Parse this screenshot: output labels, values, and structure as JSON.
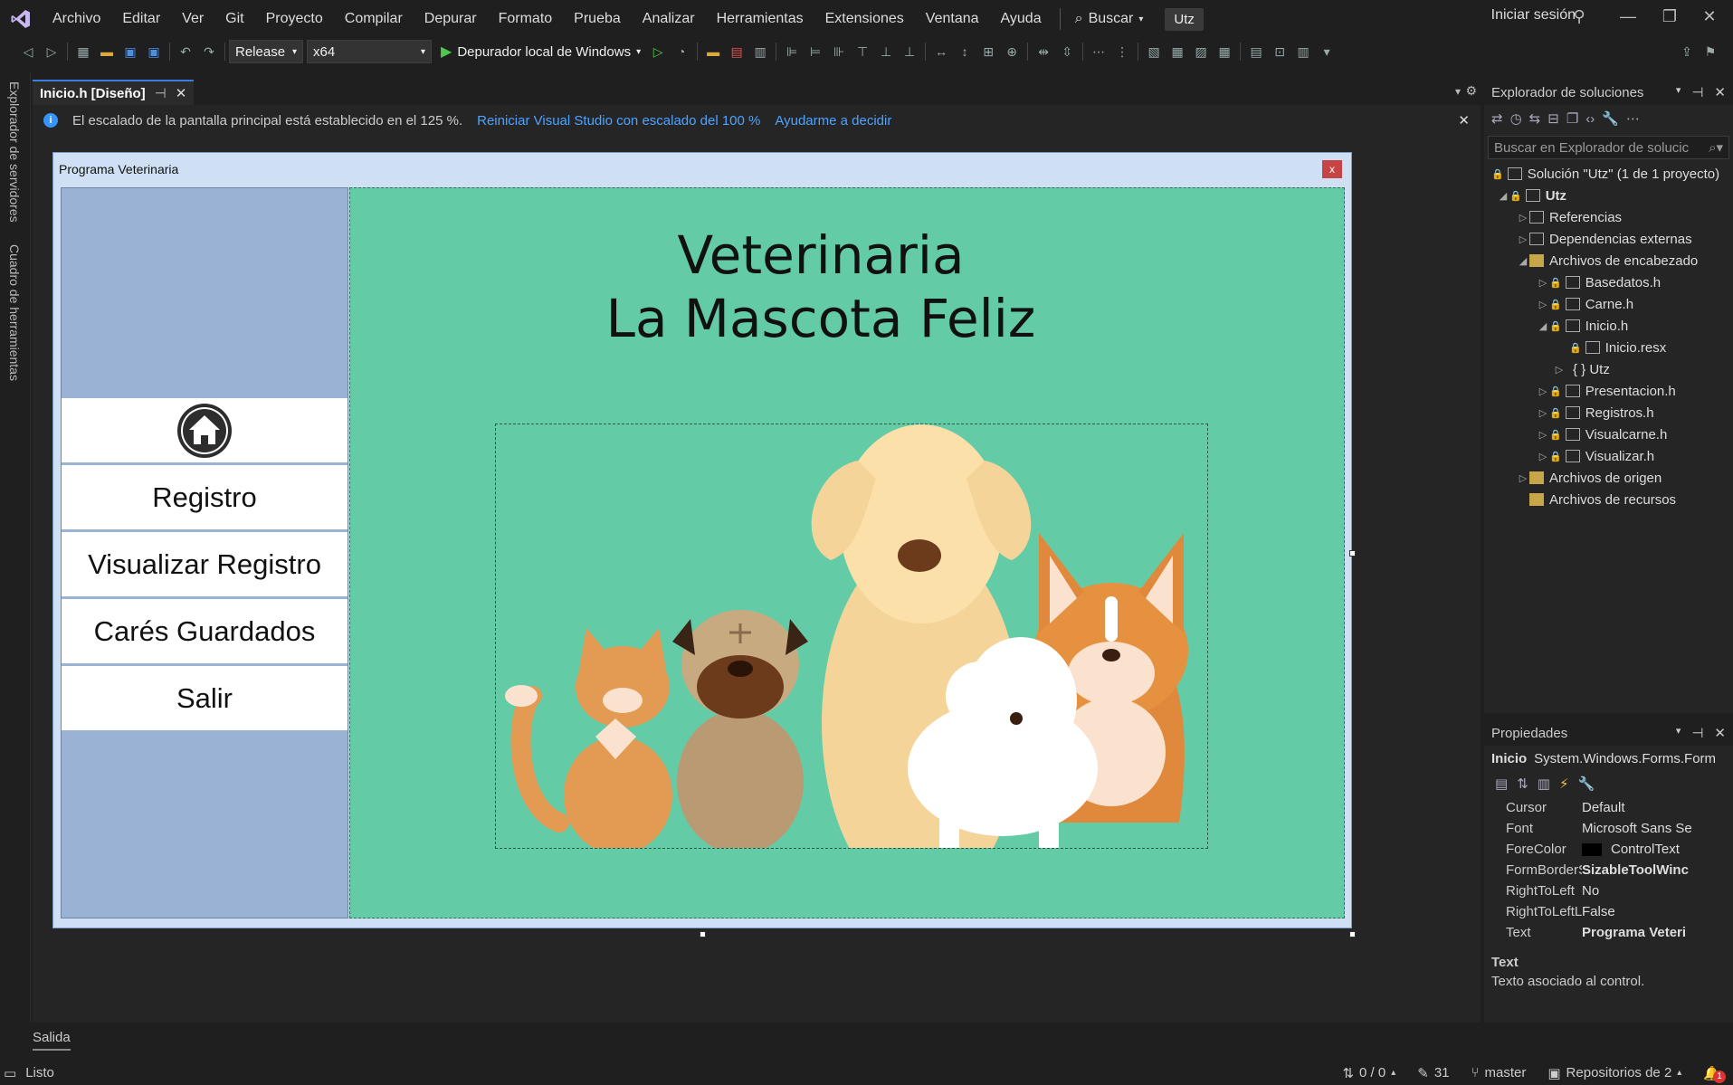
{
  "menubar": {
    "items": [
      "Archivo",
      "Editar",
      "Ver",
      "Git",
      "Proyecto",
      "Compilar",
      "Depurar",
      "Formato",
      "Prueba",
      "Analizar",
      "Herramientas",
      "Extensiones",
      "Ventana",
      "Ayuda"
    ],
    "search_label": "Buscar",
    "solution_name": "Utz",
    "sign_in": "Iniciar sesión"
  },
  "toolbar": {
    "configuration": "Release",
    "platform": "x64",
    "run_label": "Depurador local de Windows"
  },
  "left_rail": {
    "server_explorer": "Explorador de servidores",
    "toolbox": "Cuadro de herramientas"
  },
  "document": {
    "tab_title": "Inicio.h [Diseño]",
    "info_message": "El escalado de la pantalla principal está establecido en el 125 %.",
    "info_link1": "Reiniciar Visual Studio con escalado del 100 %",
    "info_link2": "Ayudarme a decidir"
  },
  "form": {
    "title": "Programa Veterinaria",
    "close_glyph": "x",
    "heading_line1": "Veterinaria",
    "heading_line2": "La Mascota Feliz",
    "nav": [
      "Registro",
      "Visualizar Registro",
      "Carés Guardados",
      "Salir"
    ],
    "colors": {
      "sidebar": "#9ab3d5",
      "content": "#63cca7"
    }
  },
  "solution_explorer": {
    "title": "Explorador de soluciones",
    "search_placeholder": "Buscar en Explorador de solucic",
    "tree": [
      {
        "label": "Solución \"Utz\"  (1 de 1 proyecto)"
      },
      {
        "label": "Utz"
      },
      {
        "label": "Referencias"
      },
      {
        "label": "Dependencias externas"
      },
      {
        "label": "Archivos de encabezado"
      },
      {
        "label": "Basedatos.h"
      },
      {
        "label": "Carne.h"
      },
      {
        "label": "Inicio.h"
      },
      {
        "label": "Inicio.resx"
      },
      {
        "label": "{ }  Utz"
      },
      {
        "label": "Presentacion.h"
      },
      {
        "label": "Registros.h"
      },
      {
        "label": "Visualcarne.h"
      },
      {
        "label": "Visualizar.h"
      },
      {
        "label": "Archivos de origen"
      },
      {
        "label": "Archivos de recursos"
      }
    ]
  },
  "properties": {
    "title": "Propiedades",
    "object_name": "Inicio",
    "object_type": "System.Windows.Forms.Form",
    "rows": [
      {
        "name": "Cursor",
        "value": "Default"
      },
      {
        "name": "Font",
        "value": "Microsoft Sans Se"
      },
      {
        "name": "ForeColor",
        "value": "ControlText"
      },
      {
        "name": "FormBorderStyl",
        "value": "SizableToolWinc"
      },
      {
        "name": "RightToLeft",
        "value": "No"
      },
      {
        "name": "RightToLeftLayc",
        "value": "False"
      },
      {
        "name": "Text",
        "value": "Programa Veteri"
      }
    ],
    "desc_title": "Text",
    "desc_text": "Texto asociado al control."
  },
  "output_tab": "Salida",
  "statusbar": {
    "ready": "Listo",
    "changes": "0 / 0",
    "edits": "31",
    "branch": "master",
    "repos": "Repositorios de 2",
    "notifications": "1"
  }
}
